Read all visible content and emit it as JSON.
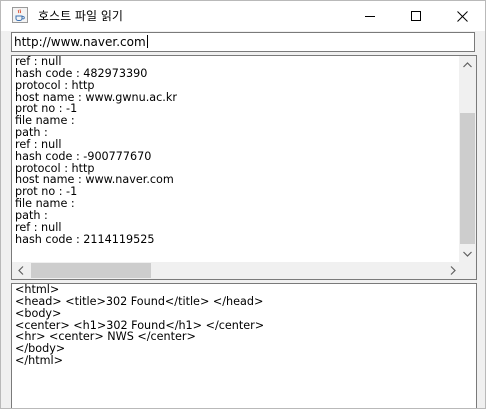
{
  "window": {
    "title": "호스트 파일 읽기",
    "icon": "java-cup-icon"
  },
  "url_field": {
    "value": "http://www.naver.com"
  },
  "top_pane": {
    "lines": [
      "ref : null",
      "hash code : 482973390",
      "protocol : http",
      "host name : www.gwnu.ac.kr",
      "prot no : -1",
      "file name :",
      "path :",
      "ref : null",
      "hash code : -900777670",
      "protocol : http",
      "host name : www.naver.com",
      "prot no : -1",
      "file name :",
      "path :",
      "ref : null",
      "hash code : 2114119525"
    ]
  },
  "bottom_pane": {
    "lines": [
      "<html>",
      "<head> <title>302 Found</title> </head>",
      "<body>",
      "<center> <h1>302 Found</h1> </center>",
      "<hr> <center> NWS </center>",
      "</body>",
      "</html>"
    ]
  },
  "colors": {
    "titlebar": "#ffffff",
    "frame": "#f0f0f0",
    "scroll_thumb": "#cdcdcd",
    "border": "#7a7a7a"
  }
}
